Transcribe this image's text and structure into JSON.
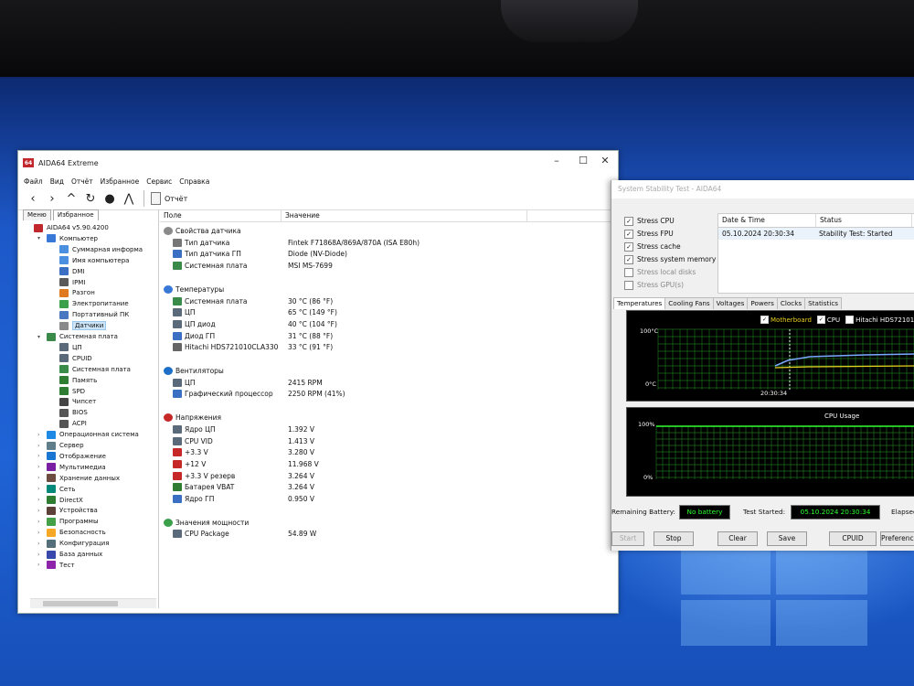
{
  "main_window": {
    "title": "AIDA64 Extreme",
    "menu": [
      "Файл",
      "Вид",
      "Отчёт",
      "Избранное",
      "Сервис",
      "Справка"
    ],
    "toolbar_report": "Отчёт",
    "left_tabs": [
      "Меню",
      "Избранное"
    ],
    "tree": [
      {
        "label": "AIDA64 v5.90.4200",
        "icon": "aida-icon",
        "level": 0,
        "twisty": ""
      },
      {
        "label": "Компьютер",
        "icon": "computer-icon",
        "level": 1,
        "twisty": "▾"
      },
      {
        "label": "Суммарная информа",
        "icon": "summary-icon",
        "level": 2,
        "twisty": ""
      },
      {
        "label": "Имя компьютера",
        "icon": "computer-name-icon",
        "level": 2,
        "twisty": ""
      },
      {
        "label": "DMI",
        "icon": "dmi-icon",
        "level": 2,
        "twisty": ""
      },
      {
        "label": "IPMI",
        "icon": "ipmi-icon",
        "level": 2,
        "twisty": ""
      },
      {
        "label": "Разгон",
        "icon": "overclock-icon",
        "level": 2,
        "twisty": ""
      },
      {
        "label": "Электропитание",
        "icon": "power-icon",
        "level": 2,
        "twisty": ""
      },
      {
        "label": "Портативный ПК",
        "icon": "portable-icon",
        "level": 2,
        "twisty": ""
      },
      {
        "label": "Датчики",
        "icon": "sensor-icon",
        "level": 2,
        "twisty": "",
        "selected": true
      },
      {
        "label": "Системная плата",
        "icon": "motherboard-icon",
        "level": 1,
        "twisty": "▾"
      },
      {
        "label": "ЦП",
        "icon": "cpu-icon",
        "level": 2,
        "twisty": ""
      },
      {
        "label": "CPUID",
        "icon": "cpuid-icon",
        "level": 2,
        "twisty": ""
      },
      {
        "label": "Системная плата",
        "icon": "board-icon",
        "level": 2,
        "twisty": ""
      },
      {
        "label": "Память",
        "icon": "memory-icon",
        "level": 2,
        "twisty": ""
      },
      {
        "label": "SPD",
        "icon": "spd-icon",
        "level": 2,
        "twisty": ""
      },
      {
        "label": "Чипсет",
        "icon": "chipset-icon",
        "level": 2,
        "twisty": ""
      },
      {
        "label": "BIOS",
        "icon": "bios-icon",
        "level": 2,
        "twisty": ""
      },
      {
        "label": "ACPI",
        "icon": "acpi-icon",
        "level": 2,
        "twisty": ""
      },
      {
        "label": "Операционная система",
        "icon": "windows-icon",
        "level": 1,
        "twisty": "›"
      },
      {
        "label": "Сервер",
        "icon": "server-icon",
        "level": 1,
        "twisty": "›"
      },
      {
        "label": "Отображение",
        "icon": "display-icon",
        "level": 1,
        "twisty": "›"
      },
      {
        "label": "Мультимедиа",
        "icon": "multimedia-icon",
        "level": 1,
        "twisty": "›"
      },
      {
        "label": "Хранение данных",
        "icon": "storage-icon",
        "level": 1,
        "twisty": "›"
      },
      {
        "label": "Сеть",
        "icon": "network-icon",
        "level": 1,
        "twisty": "›"
      },
      {
        "label": "DirectX",
        "icon": "directx-icon",
        "level": 1,
        "twisty": "›"
      },
      {
        "label": "Устройства",
        "icon": "devices-icon",
        "level": 1,
        "twisty": "›"
      },
      {
        "label": "Программы",
        "icon": "programs-icon",
        "level": 1,
        "twisty": "›"
      },
      {
        "label": "Безопасность",
        "icon": "security-icon",
        "level": 1,
        "twisty": "›"
      },
      {
        "label": "Конфигурация",
        "icon": "config-icon",
        "level": 1,
        "twisty": "›"
      },
      {
        "label": "База данных",
        "icon": "database-icon",
        "level": 1,
        "twisty": "›"
      },
      {
        "label": "Тест",
        "icon": "test-icon",
        "level": 1,
        "twisty": "›"
      }
    ],
    "columns": {
      "field": "Поле",
      "value": "Значение"
    },
    "rows": [
      {
        "type": "section",
        "label": "Свойства датчика",
        "icon": "sensor-icon"
      },
      {
        "type": "item",
        "label": "Тип датчика",
        "value": "Fintek F71868A/869A/870A  (ISA E80h)",
        "icon": "sensor-type-icon"
      },
      {
        "type": "item",
        "label": "Тип датчика ГП",
        "value": "Diode  (NV-Diode)",
        "icon": "gpu-sensor-icon"
      },
      {
        "type": "item",
        "label": "Системная плата",
        "value": "MSI MS-7699",
        "icon": "motherboard-icon"
      },
      {
        "type": "gap"
      },
      {
        "type": "section",
        "label": "Температуры",
        "icon": "thermometer-icon"
      },
      {
        "type": "item",
        "label": "Системная плата",
        "value": "30 °C  (86 °F)",
        "icon": "motherboard-icon"
      },
      {
        "type": "item",
        "label": "ЦП",
        "value": "65 °C  (149 °F)",
        "icon": "cpu-icon"
      },
      {
        "type": "item",
        "label": "ЦП диод",
        "value": "40 °C  (104 °F)",
        "icon": "cpu-icon"
      },
      {
        "type": "item",
        "label": "Диод ГП",
        "value": "31 °C  (88 °F)",
        "icon": "gpu-icon"
      },
      {
        "type": "item",
        "label": "Hitachi HDS721010CLA330",
        "value": "33 °C  (91 °F)",
        "icon": "disk-icon"
      },
      {
        "type": "gap"
      },
      {
        "type": "section",
        "label": "Вентиляторы",
        "icon": "fan-icon"
      },
      {
        "type": "item",
        "label": "ЦП",
        "value": "2415 RPM",
        "icon": "cpu-icon"
      },
      {
        "type": "item",
        "label": "Графический процессор",
        "value": "2250 RPM  (41%)",
        "icon": "gpu-icon"
      },
      {
        "type": "gap"
      },
      {
        "type": "section",
        "label": "Напряжения",
        "icon": "voltage-icon"
      },
      {
        "type": "item",
        "label": "Ядро ЦП",
        "value": "1.392 V",
        "icon": "cpu-icon"
      },
      {
        "type": "item",
        "label": "CPU VID",
        "value": "1.413 V",
        "icon": "cpu-icon"
      },
      {
        "type": "item",
        "label": "+3.3 V",
        "value": "3.280 V",
        "icon": "voltage-icon"
      },
      {
        "type": "item",
        "label": "+12 V",
        "value": "11.968 V",
        "icon": "voltage-icon"
      },
      {
        "type": "item",
        "label": "+3.3 V резерв",
        "value": "3.264 V",
        "icon": "voltage-icon"
      },
      {
        "type": "item",
        "label": "Батарея VBAT",
        "value": "3.264 V",
        "icon": "battery-icon"
      },
      {
        "type": "item",
        "label": "Ядро ГП",
        "value": "0.950 V",
        "icon": "gpu-icon"
      },
      {
        "type": "gap"
      },
      {
        "type": "section",
        "label": "Значения мощности",
        "icon": "power-icon"
      },
      {
        "type": "item",
        "label": "CPU Package",
        "value": "54.89 W",
        "icon": "cpu-icon"
      }
    ]
  },
  "stability_window": {
    "title": "System Stability Test - AIDA64",
    "stress_options": [
      {
        "label": "Stress CPU",
        "checked": true
      },
      {
        "label": "Stress FPU",
        "checked": true
      },
      {
        "label": "Stress cache",
        "checked": true
      },
      {
        "label": "Stress system memory",
        "checked": true
      },
      {
        "label": "Stress local disks",
        "checked": false
      },
      {
        "label": "Stress GPU(s)",
        "checked": false
      }
    ],
    "log_columns": {
      "date": "Date & Time",
      "status": "Status"
    },
    "log_rows": [
      {
        "date": "05.10.2024 20:30:34",
        "status": "Stability Test: Started"
      }
    ],
    "tabs": [
      "Temperatures",
      "Cooling Fans",
      "Voltages",
      "Powers",
      "Clocks",
      "Statistics"
    ],
    "temp_graph": {
      "legend": [
        {
          "label": "Motherboard",
          "color": "#e8d020",
          "checked": true
        },
        {
          "label": "CPU",
          "color": "#ffffff",
          "checked": true
        },
        {
          "label": "Hitachi HDS72101",
          "color": "#ffffff",
          "checked": false
        }
      ],
      "top_label": "100°C",
      "bottom_label": "0°C",
      "time_label": "20:30:34"
    },
    "cpu_graph": {
      "title": "CPU Usage",
      "top_label": "100%",
      "bottom_label": "0%"
    },
    "remaining_battery_label": "Remaining Battery:",
    "remaining_battery_value": "No battery",
    "test_started_label": "Test Started:",
    "test_started_value": "05.10.2024 20:30:34",
    "elapsed_label": "Elapsed",
    "buttons": {
      "start": "Start",
      "stop": "Stop",
      "clear": "Clear",
      "save": "Save",
      "cpuid": "CPUID",
      "prefs": "Preferences"
    }
  }
}
